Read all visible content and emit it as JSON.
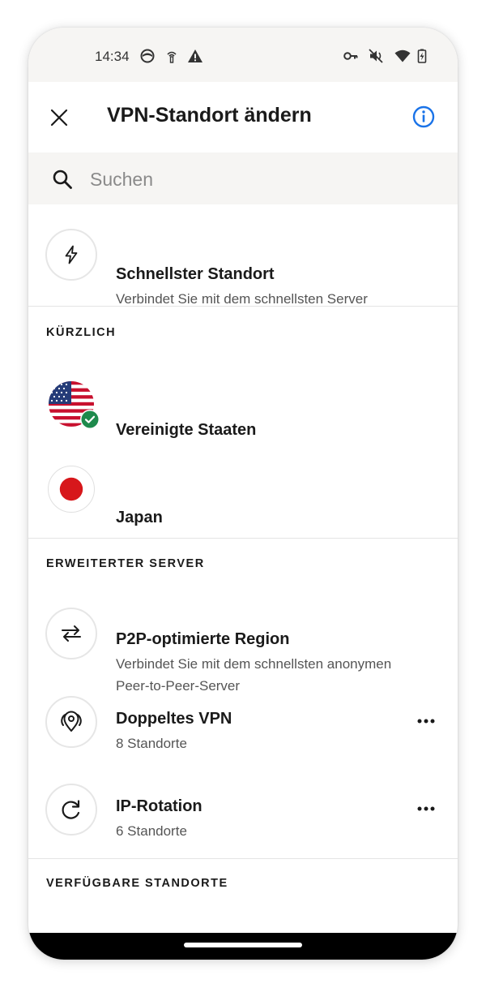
{
  "status_bar": {
    "time": "14:34",
    "left_icons": [
      "vpn-shield-icon",
      "hotspot-icon",
      "warning-icon"
    ],
    "right_icons": [
      "key-icon",
      "mute-icon",
      "wifi-icon",
      "battery-icon"
    ]
  },
  "app_bar": {
    "title": "VPN-Standort ändern",
    "close_icon": "close-icon",
    "info_icon": "info-icon",
    "accent_color": "#1a73e8"
  },
  "search": {
    "placeholder": "Suchen",
    "value": ""
  },
  "fastest": {
    "title": "Schnellster Standort",
    "subtitle": "Verbindet Sie mit dem schnellsten Server",
    "icon": "lightning-icon"
  },
  "recent": {
    "header": "KÜRZLICH",
    "items": [
      {
        "label": "Vereinigte Staaten",
        "flag": "us-flag-icon",
        "connected": true
      },
      {
        "label": "Japan",
        "flag": "japan-flag-icon",
        "connected": false
      }
    ]
  },
  "advanced": {
    "header": "ERWEITERTER SERVER",
    "items": [
      {
        "title": "P2P-optimierte Region",
        "subtitle_line1": "Verbindet Sie mit dem schnellsten anonymen",
        "subtitle_line2": "Peer-to-Peer-Server",
        "icon": "swap-arrows-icon"
      },
      {
        "title": "Doppeltes VPN",
        "subtitle": "8 Standorte",
        "icon": "double-pin-icon"
      },
      {
        "title": "IP-Rotation",
        "subtitle": "6 Standorte",
        "icon": "rotate-icon"
      }
    ]
  },
  "available": {
    "header": "VERFÜGBARE STANDORTE"
  },
  "colors": {
    "connected_badge": "#1e8a4c",
    "japan_red": "#d7171b",
    "us_red": "#c8102e",
    "us_blue": "#253c78"
  }
}
